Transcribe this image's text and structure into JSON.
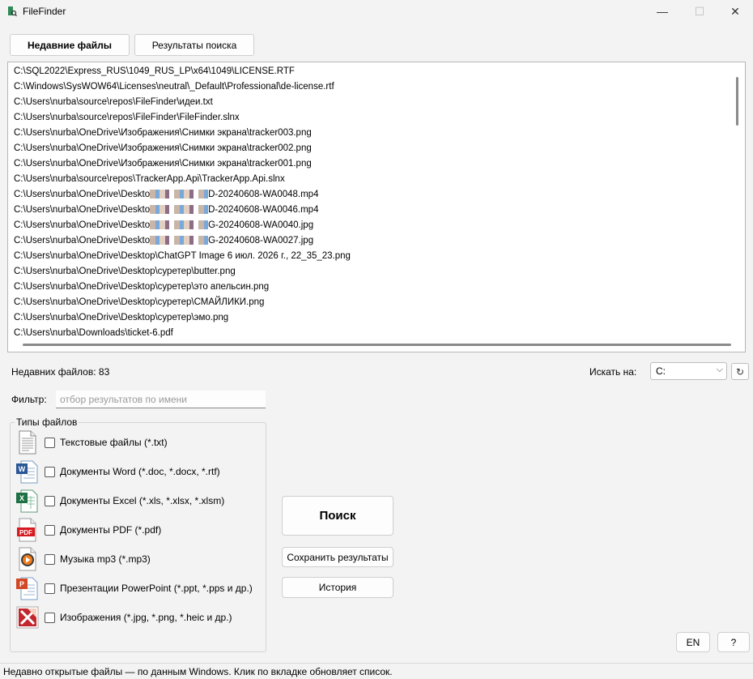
{
  "window": {
    "title": "FileFinder",
    "minimize": "—",
    "maximize": "☐",
    "close": "✕"
  },
  "tabs": [
    {
      "label": "Недавние файлы",
      "active": true
    },
    {
      "label": "Результаты поиска",
      "active": false
    }
  ],
  "files": [
    "C:\\SQL2022\\Express_RUS\\1049_RUS_LP\\x64\\1049\\LICENSE.RTF",
    "C:\\Windows\\SysWOW64\\Licenses\\neutral\\_Default\\Professional\\de-license.rtf",
    "C:\\Users\\nurba\\source\\repos\\FileFinder\\идеи.txt",
    "C:\\Users\\nurba\\source\\repos\\FileFinder\\FileFinder.slnx",
    "C:\\Users\\nurba\\OneDrive\\Изображения\\Снимки экрана\\tracker003.png",
    "C:\\Users\\nurba\\OneDrive\\Изображения\\Снимки экрана\\tracker002.png",
    "C:\\Users\\nurba\\OneDrive\\Изображения\\Снимки экрана\\tracker001.png",
    "C:\\Users\\nurba\\source\\repos\\TrackerApp.Api\\TrackerApp.Api.slnx",
    [
      "C:\\Users\\nurba\\OneDrive\\Deskto",
      "D-20240608-WA0048.mp4"
    ],
    [
      "C:\\Users\\nurba\\OneDrive\\Deskto",
      "D-20240608-WA0046.mp4"
    ],
    [
      "C:\\Users\\nurba\\OneDrive\\Deskto",
      "G-20240608-WA0040.jpg"
    ],
    [
      "C:\\Users\\nurba\\OneDrive\\Deskto",
      "G-20240608-WA0027.jpg"
    ],
    "C:\\Users\\nurba\\OneDrive\\Desktop\\ChatGPT Image 6 июл. 2026 г., 22_35_23.png",
    "C:\\Users\\nurba\\OneDrive\\Desktop\\суретер\\butter.png",
    "C:\\Users\\nurba\\OneDrive\\Desktop\\суретер\\это апельсин.png",
    "C:\\Users\\nurba\\OneDrive\\Desktop\\суретер\\СМАЙЛИКИ.png",
    "C:\\Users\\nurba\\OneDrive\\Desktop\\суретер\\эмо.png",
    "C:\\Users\\nurba\\Downloads\\ticket-6.pdf"
  ],
  "recent_count": "Недавних файлов: 83",
  "search_on": {
    "label": "Искать на:",
    "value": "C:",
    "refresh": "↻"
  },
  "filter": {
    "label": "Фильтр:",
    "placeholder": "отбор результатов по имени"
  },
  "file_types": {
    "title": "Типы файлов",
    "items": [
      {
        "label": "Текстовые файлы (*.txt)",
        "icon": "text-file-icon",
        "checked": false
      },
      {
        "label": "Документы Word (*.doc, *.docx, *.rtf)",
        "icon": "word-file-icon",
        "checked": false
      },
      {
        "label": "Документы Excel (*.xls, *.xlsx, *.xlsm)",
        "icon": "excel-file-icon",
        "checked": false
      },
      {
        "label": "Документы PDF (*.pdf)",
        "icon": "pdf-file-icon",
        "checked": false
      },
      {
        "label": "Музыка mp3 (*.mp3)",
        "icon": "audio-file-icon",
        "checked": false
      },
      {
        "label": "Презентации PowerPoint (*.ppt, *.pps и др.)",
        "icon": "powerpoint-file-icon",
        "checked": false
      },
      {
        "label": "Изображения (*.jpg, *.png, *.heic и др.)",
        "icon": "image-file-icon",
        "checked": false
      }
    ]
  },
  "buttons": {
    "search": "Поиск",
    "save": "Сохранить результаты",
    "history": "История",
    "lang": "EN",
    "help": "?"
  },
  "status": "Недавно открытые файлы — по данным Windows. Клик по вкладке обновляет список.",
  "icon_labels": {
    "word": "W",
    "excel": "X",
    "pdf": "PDF",
    "powerpoint": "P"
  },
  "colors": {
    "word": "#2b5797",
    "excel": "#1e7145",
    "pdf": "#d71920",
    "powerpoint": "#d24726",
    "image": "#c1272d"
  }
}
